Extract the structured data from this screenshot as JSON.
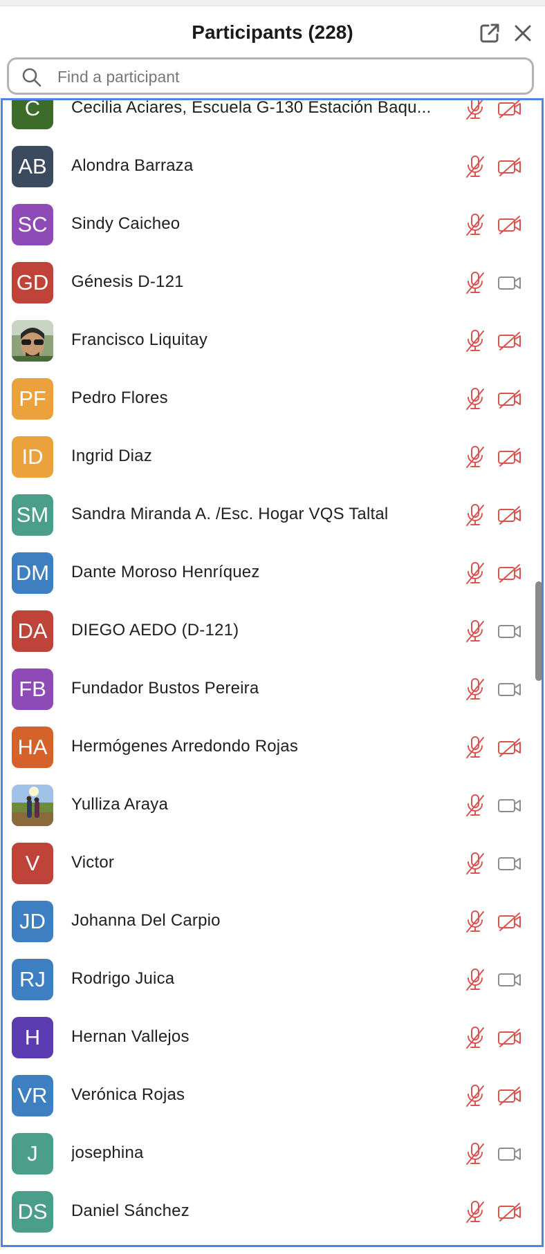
{
  "header": {
    "title": "Participants (228)"
  },
  "search": {
    "placeholder": "Find a participant",
    "value": ""
  },
  "participants": [
    {
      "initials": "C",
      "name": "Cecilia Aciares, Escuela G-130 Estación Baqu...",
      "color": "#3d6b2a",
      "mic": "muted",
      "video": "off"
    },
    {
      "initials": "AB",
      "name": "Alondra Barraza",
      "color": "#3b4a5e",
      "mic": "muted",
      "video": "off"
    },
    {
      "initials": "SC",
      "name": "Sindy Caicheo",
      "color": "#8e4bb8",
      "mic": "muted",
      "video": "off"
    },
    {
      "initials": "GD",
      "name": "Génesis D-121",
      "color": "#c0433a",
      "mic": "muted",
      "video": "on"
    },
    {
      "initials": "",
      "name": "Francisco Liquitay",
      "color": "#6d7a5a",
      "photo": "man-sunglasses",
      "mic": "muted",
      "video": "off"
    },
    {
      "initials": "PF",
      "name": "Pedro Flores",
      "color": "#eba23c",
      "mic": "muted",
      "video": "off"
    },
    {
      "initials": "ID",
      "name": "Ingrid Diaz",
      "color": "#eba23c",
      "mic": "muted",
      "video": "off"
    },
    {
      "initials": "SM",
      "name": "Sandra Miranda A. /Esc. Hogar VQS Taltal",
      "color": "#4a9e8a",
      "mic": "muted",
      "video": "off"
    },
    {
      "initials": "DM",
      "name": "Dante Moroso Henríquez",
      "color": "#3e7fc1",
      "mic": "muted",
      "video": "off"
    },
    {
      "initials": "DA",
      "name": "DIEGO AEDO (D-121)",
      "color": "#c0433a",
      "mic": "muted",
      "video": "on"
    },
    {
      "initials": "FB",
      "name": "Fundador Bustos Pereira",
      "color": "#8e4bb8",
      "mic": "muted",
      "video": "on"
    },
    {
      "initials": "HA",
      "name": "Hermógenes Arredondo Rojas",
      "color": "#d4622a",
      "mic": "muted",
      "video": "off"
    },
    {
      "initials": "",
      "name": "Yulliza Araya",
      "color": "#7a8c6a",
      "photo": "outdoor-field",
      "mic": "muted",
      "video": "on"
    },
    {
      "initials": "V",
      "name": "Victor",
      "color": "#c0433a",
      "mic": "muted",
      "video": "on"
    },
    {
      "initials": "JD",
      "name": "Johanna Del Carpio",
      "color": "#3e7fc1",
      "mic": "muted",
      "video": "off"
    },
    {
      "initials": "RJ",
      "name": "Rodrigo Juica",
      "color": "#3e7fc1",
      "mic": "muted",
      "video": "on"
    },
    {
      "initials": "H",
      "name": "Hernan Vallejos",
      "color": "#5b3bb0",
      "mic": "muted",
      "video": "off"
    },
    {
      "initials": "VR",
      "name": "Verónica Rojas",
      "color": "#3e7fc1",
      "mic": "muted",
      "video": "off"
    },
    {
      "initials": "J",
      "name": "josephina",
      "color": "#4a9e8a",
      "mic": "muted",
      "video": "on"
    },
    {
      "initials": "DS",
      "name": "Daniel Sánchez",
      "color": "#4a9e8a",
      "mic": "muted",
      "video": "off"
    }
  ],
  "icons": {
    "popout": "popout-icon",
    "close": "close-icon",
    "search": "search-icon",
    "mic_muted": "mic-muted-icon",
    "video_off": "video-off-icon",
    "video_on": "video-icon"
  },
  "colors": {
    "muted_red": "#d9534f",
    "video_gray": "#8c8c8c",
    "focus_blue": "#4a87e0"
  }
}
